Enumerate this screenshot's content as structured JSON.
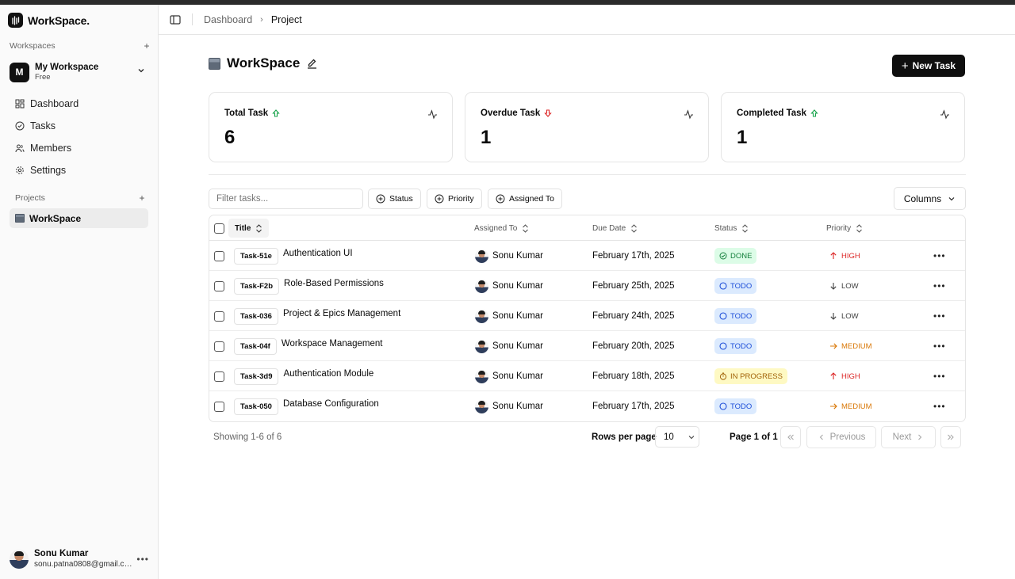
{
  "app": {
    "name": "WorkSpace."
  },
  "sidebar": {
    "workspaces_label": "Workspaces",
    "workspace": {
      "initial": "M",
      "name": "My Workspace",
      "plan": "Free"
    },
    "nav": [
      {
        "label": "Dashboard",
        "icon": "dashboard-icon"
      },
      {
        "label": "Tasks",
        "icon": "check-circle-icon"
      },
      {
        "label": "Members",
        "icon": "users-icon"
      },
      {
        "label": "Settings",
        "icon": "gear-icon"
      }
    ],
    "projects_label": "Projects",
    "projects": [
      {
        "label": "WorkSpace"
      }
    ],
    "user": {
      "name": "Sonu Kumar",
      "email": "sonu.patna0808@gmail.co..."
    }
  },
  "header": {
    "breadcrumb": [
      "Dashboard",
      "Project"
    ]
  },
  "main": {
    "title": "WorkSpace",
    "new_task_label": "New Task",
    "stats": [
      {
        "label": "Total Task",
        "value": "6",
        "trend": "up",
        "trend_color": "#16a34a"
      },
      {
        "label": "Overdue Task",
        "value": "1",
        "trend": "down",
        "trend_color": "#dc2626"
      },
      {
        "label": "Completed Task",
        "value": "1",
        "trend": "up",
        "trend_color": "#16a34a"
      }
    ],
    "filter_placeholder": "Filter tasks...",
    "filters": [
      "Status",
      "Priority",
      "Assigned To"
    ],
    "columns_label": "Columns",
    "table": {
      "headers": {
        "title": "Title",
        "assigned": "Assigned To",
        "due": "Due Date",
        "status": "Status",
        "priority": "Priority"
      },
      "rows": [
        {
          "id": "Task-51e",
          "title": "Authentication UI",
          "assignee": "Sonu Kumar",
          "due": "February 17th, 2025",
          "status": "DONE",
          "priority": "HIGH"
        },
        {
          "id": "Task-F2b",
          "title": "Role-Based Permissions",
          "assignee": "Sonu Kumar",
          "due": "February 25th, 2025",
          "status": "TODO",
          "priority": "LOW"
        },
        {
          "id": "Task-036",
          "title": "Project & Epics Management",
          "assignee": "Sonu Kumar",
          "due": "February 24th, 2025",
          "status": "TODO",
          "priority": "LOW"
        },
        {
          "id": "Task-04f",
          "title": "Workspace Management",
          "assignee": "Sonu Kumar",
          "due": "February 20th, 2025",
          "status": "TODO",
          "priority": "MEDIUM"
        },
        {
          "id": "Task-3d9",
          "title": "Authentication Module",
          "assignee": "Sonu Kumar",
          "due": "February 18th, 2025",
          "status": "IN PROGRESS",
          "priority": "HIGH"
        },
        {
          "id": "Task-050",
          "title": "Database Configuration",
          "assignee": "Sonu Kumar",
          "due": "February 17th, 2025",
          "status": "TODO",
          "priority": "MEDIUM"
        }
      ]
    },
    "pagination": {
      "showing": "Showing 1-6 of 6",
      "rows_per_page_label": "Rows per page",
      "rows_per_page": "10",
      "page_label": "Page 1 of 1",
      "previous": "Previous",
      "next": "Next"
    }
  },
  "colors": {
    "done_bg": "#dcfce7",
    "done_fg": "#15803d",
    "todo_bg": "#dbeafe",
    "todo_fg": "#1d4ed8",
    "progress_bg": "#fef9c3",
    "progress_fg": "#a16207",
    "high": "#dc2626",
    "low": "#404040",
    "medium": "#d97706"
  }
}
